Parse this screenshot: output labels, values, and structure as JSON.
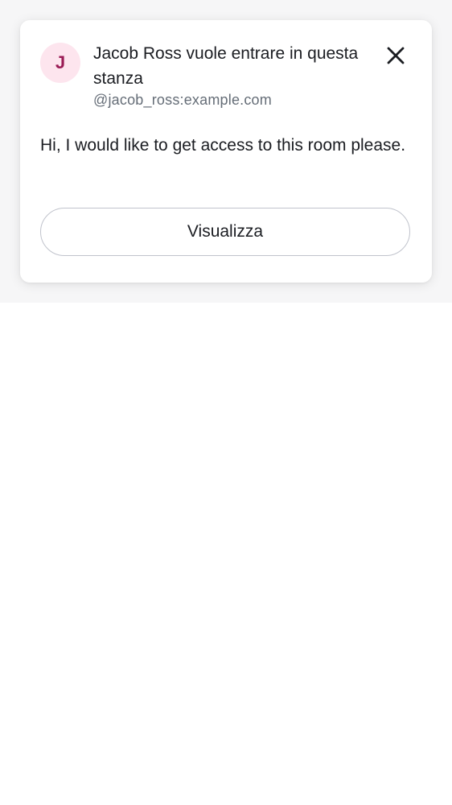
{
  "notification": {
    "avatar_initial": "J",
    "title": "Jacob Ross vuole entrare in questa stanza",
    "user_id": "@jacob_ross:example.com",
    "message": "Hi, I would like to get access to this room please.",
    "view_button_label": "Visualizza",
    "close_icon": "close-icon"
  },
  "colors": {
    "avatar_background": "#fde5ee",
    "avatar_text": "#9a1b55",
    "primary_text": "#1b1d22",
    "secondary_text": "#656d77",
    "button_border": "#c0c3cc"
  }
}
